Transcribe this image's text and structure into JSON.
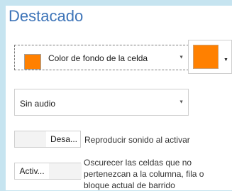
{
  "section": {
    "title": "Destacado"
  },
  "highlight_dropdown": {
    "selected": "Color de fondo de la celda",
    "swatch_color": "#ff8000",
    "caret_icon": "chevron-down-icon"
  },
  "color_picker": {
    "color": "#ff8000",
    "caret_icon": "chevron-down-icon"
  },
  "audio_dropdown": {
    "selected": "Sin audio",
    "caret_icon": "chevron-down-icon"
  },
  "sound_toggle": {
    "state_label": "Desa...",
    "description": "Reproducir sonido al activar"
  },
  "dim_toggle": {
    "state_label": "Activ...",
    "description_lines": [
      "Oscurecer las celdas que no",
      "pertenezcan a la columna, fila o",
      "bloque actual de barrido"
    ]
  }
}
